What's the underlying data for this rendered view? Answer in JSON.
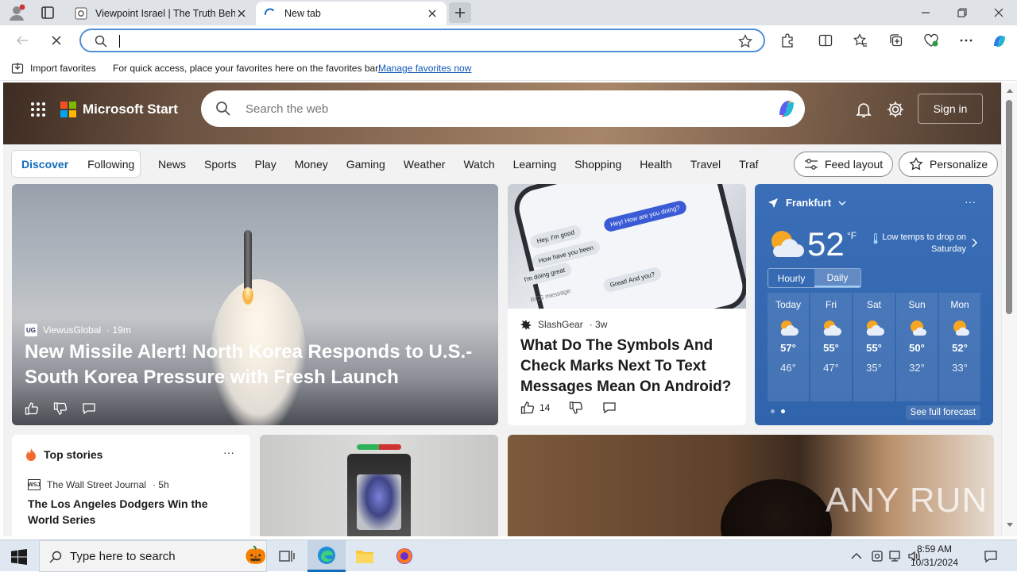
{
  "browser": {
    "tabs": [
      {
        "title": "Viewpoint Israel | The Truth Behin"
      },
      {
        "title": "New tab"
      }
    ],
    "address": {
      "value": "",
      "placeholder": ""
    },
    "favorites_bar": {
      "import_label": "Import favorites",
      "hint": "For quick access, place your favorites here on the favorites bar.",
      "manage_link": "Manage favorites now"
    }
  },
  "page": {
    "brand": "Microsoft Start",
    "search_placeholder": "Search the web",
    "sign_in": "Sign in",
    "feed_toggle": {
      "discover": "Discover",
      "following": "Following"
    },
    "categories": [
      "News",
      "Sports",
      "Play",
      "Money",
      "Gaming",
      "Weather",
      "Watch",
      "Learning",
      "Shopping",
      "Health",
      "Travel",
      "Traf"
    ],
    "feed_layout": "Feed layout",
    "personalize": "Personalize",
    "lead_story": {
      "source_badge": "UG",
      "source": "ViewusGlobal",
      "age": "· 19m",
      "title": "New Missile Alert! North Korea Responds to U.S.-South Korea Pressure with Fresh Launch"
    },
    "phone_story": {
      "source": "SlashGear",
      "age": "· 3w",
      "title": "What Do The Symbols And Check Marks Next To Text Messages Mean On Android?",
      "likes": "14",
      "bubbles": [
        "Hey! How are you doing?",
        "Hey, I'm good",
        "How have you been",
        "I'm doing great",
        "Great! And you?",
        "RCS message"
      ]
    },
    "weather": {
      "location": "Frankfurt",
      "temp": "52",
      "unit": "°F",
      "alert": "Low temps to drop on Saturday",
      "tabs": {
        "hourly": "Hourly",
        "daily": "Daily"
      },
      "days": [
        {
          "name": "Today",
          "hi": "57°",
          "lo": "46°",
          "icon": "partly-cloudy-icon"
        },
        {
          "name": "Fri",
          "hi": "55°",
          "lo": "47°",
          "icon": "partly-cloudy-icon"
        },
        {
          "name": "Sat",
          "hi": "55°",
          "lo": "35°",
          "icon": "partly-cloudy-icon"
        },
        {
          "name": "Sun",
          "hi": "50°",
          "lo": "32°",
          "icon": "mostly-sunny-icon"
        },
        {
          "name": "Mon",
          "hi": "52°",
          "lo": "33°",
          "icon": "mostly-sunny-icon"
        }
      ],
      "see_full": "See full forecast"
    },
    "top_stories": {
      "header": "Top stories",
      "source_badge": "WSJ",
      "source": "The Wall Street Journal",
      "age": "· 5h",
      "title": "The Los Angeles Dodgers Win the World Series"
    },
    "watermark": "ANY RUN"
  },
  "taskbar": {
    "search_placeholder": "Type here to search",
    "time": "8:59 AM",
    "date": "10/31/2024"
  },
  "colors": {
    "accent": "#0f6cbd",
    "weather_bg": "#3a6fb8"
  }
}
